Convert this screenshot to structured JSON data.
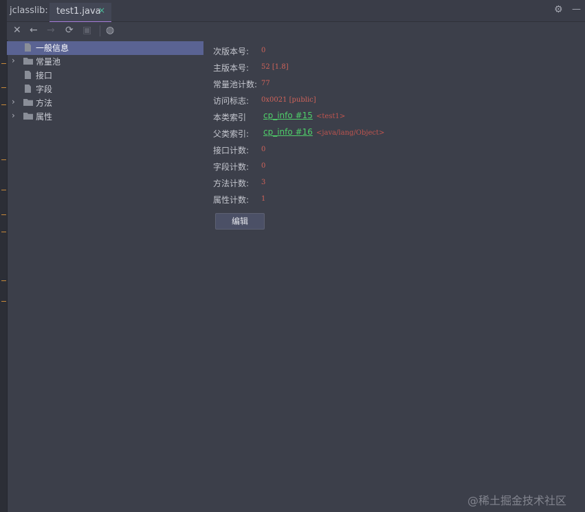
{
  "header": {
    "tool_title": "jclasslib:",
    "tabs": [
      {
        "label": "test1.java",
        "close": "×"
      }
    ],
    "icons": {
      "settings": "gear-icon",
      "minimize": "minimize-icon"
    }
  },
  "toolbar": {
    "buttons": [
      {
        "name": "close-icon",
        "glyph": "✕"
      },
      {
        "name": "back-icon",
        "glyph": "←"
      },
      {
        "name": "forward-icon",
        "glyph": "→"
      },
      {
        "name": "refresh-icon",
        "glyph": "⟳"
      },
      {
        "name": "save-icon",
        "glyph": "▣"
      },
      {
        "name": "browser-icon",
        "glyph": "◍"
      }
    ]
  },
  "tree": {
    "items": [
      {
        "label": "一般信息",
        "type": "file",
        "selected": true
      },
      {
        "label": "常量池",
        "type": "folder",
        "expandable": true
      },
      {
        "label": "接口",
        "type": "file"
      },
      {
        "label": "字段",
        "type": "file"
      },
      {
        "label": "方法",
        "type": "folder",
        "expandable": true
      },
      {
        "label": "属性",
        "type": "folder",
        "expandable": true
      }
    ]
  },
  "info": {
    "minor_label": "次版本号:",
    "minor_value": "0",
    "major_label": "主版本号:",
    "major_value": "52 [1.8]",
    "cp_count_label": "常量池计数:",
    "cp_count_value": "77",
    "access_label": "访问标志:",
    "access_value": "0x0021 [public]",
    "this_class_label": "本类索引",
    "this_class_link": "cp_info #15",
    "this_class_comment": "<test1>",
    "super_class_label": "父类索引:",
    "super_class_link": "cp_info #16",
    "super_class_comment": "<java/lang/Object>",
    "interfaces_label": "接口计数:",
    "interfaces_value": "0",
    "fields_label": "字段计数:",
    "fields_value": "0",
    "methods_label": "方法计数:",
    "methods_value": "3",
    "attributes_label": "属性计数:",
    "attributes_value": "1",
    "edit_button": "编辑"
  },
  "watermark": "@稀土掘金技术社区",
  "colors": {
    "selection": "#5a6393",
    "value_red": "#d0635a",
    "link_green": "#4fd06a",
    "tab_accent": "#a87bdc"
  }
}
